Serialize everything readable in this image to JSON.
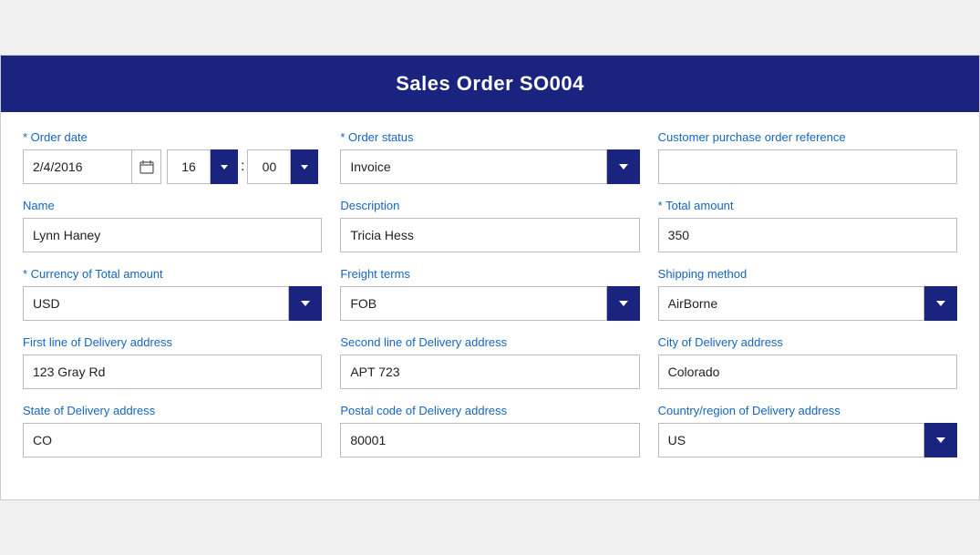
{
  "header": {
    "title": "Sales Order SO004"
  },
  "fields": {
    "order_date_label": "Order date",
    "order_date_value": "2/4/2016",
    "order_date_hour": "16",
    "order_date_minute": "00",
    "order_status_label": "Order status",
    "order_status_value": "Invoice",
    "customer_po_ref_label": "Customer purchase order reference",
    "customer_po_ref_value": "",
    "name_label": "Name",
    "name_value": "Lynn Haney",
    "description_label": "Description",
    "description_value": "Tricia Hess",
    "total_amount_label": "Total amount",
    "total_amount_value": "350",
    "currency_label": "Currency of Total amount",
    "currency_value": "USD",
    "freight_terms_label": "Freight terms",
    "freight_terms_value": "FOB",
    "shipping_method_label": "Shipping method",
    "shipping_method_value": "AirBorne",
    "delivery_line1_label": "First line of Delivery address",
    "delivery_line1_value": "123 Gray Rd",
    "delivery_line2_label": "Second line of Delivery address",
    "delivery_line2_value": "APT 723",
    "delivery_city_label": "City of Delivery address",
    "delivery_city_value": "Colorado",
    "delivery_state_label": "State of Delivery address",
    "delivery_state_value": "CO",
    "delivery_postal_label": "Postal code of Delivery address",
    "delivery_postal_value": "80001",
    "delivery_country_label": "Country/region of Delivery address",
    "delivery_country_value": "US"
  },
  "chevron_char": "▾",
  "calendar_char": "📅"
}
